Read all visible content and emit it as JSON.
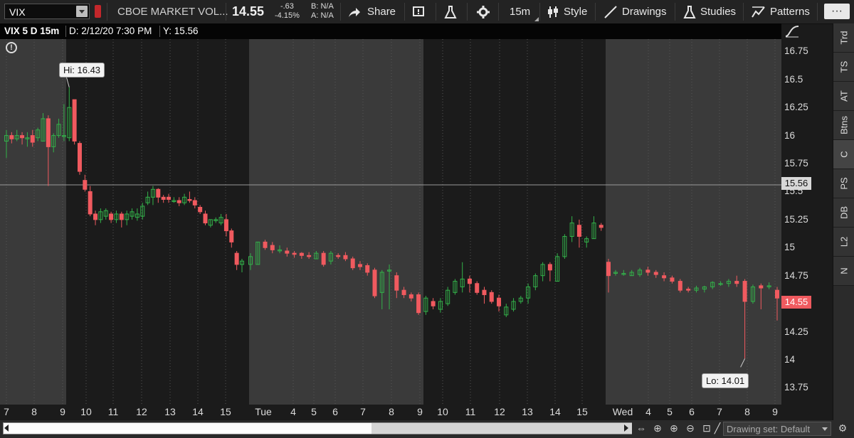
{
  "toolbar": {
    "symbol": "VIX",
    "description": "CBOE MARKET VOL...",
    "last_price": "14.55",
    "net_change": "-.63",
    "pct_change": "-4.15%",
    "bid": "B: N/A",
    "ask": "A: N/A",
    "share_label": "Share",
    "timeframe_label": "15m",
    "style_label": "Style",
    "drawings_label": "Drawings",
    "studies_label": "Studies",
    "patterns_label": "Patterns"
  },
  "header": {
    "title": "VIX 5 D 15m",
    "date": "D: 2/12/20 7:30 PM",
    "y_value": "Y: 15.56"
  },
  "price_axis": {
    "labels": [
      "16.75",
      "16.5",
      "16.25",
      "16",
      "15.75",
      "15.5",
      "15.25",
      "15",
      "14.75",
      "14.5",
      "14.25",
      "14",
      "13.75"
    ],
    "crosshair_value": "15.56",
    "last_value": "14.55"
  },
  "time_axis": {
    "labels": [
      "7",
      "8",
      "9",
      "10",
      "11",
      "12",
      "13",
      "14",
      "15",
      "Tue",
      "4",
      "5",
      "6",
      "7",
      "8",
      "9",
      "10",
      "11",
      "12",
      "13",
      "14",
      "15",
      "Wed",
      "4",
      "5",
      "6",
      "7",
      "8",
      "9"
    ]
  },
  "callouts": {
    "high": "Hi: 16.43",
    "low": "Lo: 14.01"
  },
  "right_tabs": [
    "Trd",
    "TS",
    "AT",
    "Btns",
    "C",
    "PS",
    "DB",
    "L2",
    "N"
  ],
  "footer": {
    "drawing_set": "Drawing set: Default"
  },
  "colors": {
    "up": "#33b24a",
    "down": "#f05a5f",
    "band_light": "#3a3a3a",
    "band_dark": "#1b1b1b",
    "crosshair": "#9a9a9a",
    "accent": "#3da8e0"
  },
  "chart_data": {
    "type": "candlestick",
    "ylim": [
      13.6,
      16.86
    ],
    "last_price": 14.55,
    "crosshair_y": 15.56,
    "high": 16.43,
    "low": 14.01,
    "candles": [
      [
        15.95,
        16.0,
        15.8,
        16.05
      ],
      [
        16.0,
        15.97,
        15.93,
        16.03
      ],
      [
        15.97,
        16.0,
        15.95,
        16.05
      ],
      [
        16.0,
        15.98,
        15.92,
        16.03
      ],
      [
        15.97,
        15.98,
        15.9,
        16.03
      ],
      [
        16.0,
        15.94,
        15.9,
        16.05
      ],
      [
        15.98,
        16.05,
        15.95,
        16.07
      ],
      [
        15.95,
        16.15,
        15.95,
        16.2
      ],
      [
        16.15,
        15.9,
        15.55,
        16.18
      ],
      [
        15.9,
        16.0,
        15.85,
        16.02
      ],
      [
        16.0,
        16.1,
        15.98,
        16.15
      ],
      [
        16.0,
        16.0,
        15.95,
        16.28
      ],
      [
        15.98,
        16.25,
        15.95,
        16.43
      ],
      [
        16.32,
        15.95,
        15.92,
        16.32
      ],
      [
        15.93,
        15.68,
        15.65,
        15.95
      ],
      [
        15.6,
        15.52,
        15.5,
        15.65
      ],
      [
        15.5,
        15.3,
        15.28,
        15.55
      ],
      [
        15.3,
        15.25,
        15.2,
        15.33
      ],
      [
        15.25,
        15.32,
        15.22,
        15.35
      ],
      [
        15.28,
        15.33,
        15.25,
        15.35
      ],
      [
        15.3,
        15.25,
        15.22,
        15.32
      ],
      [
        15.25,
        15.3,
        15.22,
        15.33
      ],
      [
        15.3,
        15.25,
        15.18,
        15.32
      ],
      [
        15.25,
        15.3,
        15.2,
        15.33
      ],
      [
        15.28,
        15.32,
        15.25,
        15.35
      ],
      [
        15.27,
        15.3,
        15.24,
        15.35
      ],
      [
        15.28,
        15.37,
        15.25,
        15.4
      ],
      [
        15.4,
        15.45,
        15.38,
        15.5
      ],
      [
        15.45,
        15.52,
        15.38,
        15.55
      ],
      [
        15.52,
        15.45,
        15.4,
        15.53
      ],
      [
        15.45,
        15.43,
        15.4,
        15.47
      ],
      [
        15.45,
        15.43,
        15.4,
        15.48
      ],
      [
        15.42,
        15.42,
        15.4,
        15.45
      ],
      [
        15.42,
        15.4,
        15.37,
        15.45
      ],
      [
        15.4,
        15.45,
        15.38,
        15.48
      ],
      [
        15.43,
        15.42,
        15.4,
        15.5
      ],
      [
        15.42,
        15.38,
        15.35,
        15.45
      ],
      [
        15.36,
        15.32,
        15.3,
        15.38
      ],
      [
        15.3,
        15.22,
        15.2,
        15.33
      ],
      [
        15.2,
        15.25,
        15.18,
        15.25
      ],
      [
        15.25,
        15.25,
        15.22,
        15.27
      ],
      [
        15.22,
        15.27,
        15.2,
        15.3
      ],
      [
        15.25,
        15.15,
        15.1,
        15.3
      ],
      [
        15.15,
        15.05,
        15.0,
        15.17
      ],
      [
        14.95,
        14.85,
        14.8,
        14.97
      ],
      [
        14.85,
        14.88,
        14.78,
        14.9
      ],
      [
        14.85,
        14.92,
        14.8,
        14.95
      ],
      [
        14.85,
        15.05,
        14.85,
        15.05
      ],
      [
        15.05,
        15.0,
        14.98,
        15.07
      ],
      [
        15.02,
        14.98,
        14.95,
        15.05
      ],
      [
        14.98,
        14.98,
        14.95,
        15.02
      ],
      [
        14.97,
        14.95,
        14.92,
        15.0
      ],
      [
        14.95,
        14.94,
        14.91,
        14.97
      ],
      [
        14.95,
        14.93,
        14.9,
        14.96
      ],
      [
        14.93,
        14.92,
        14.9,
        14.96
      ],
      [
        14.9,
        14.95,
        14.9,
        14.97
      ],
      [
        14.95,
        14.85,
        14.83,
        14.97
      ],
      [
        14.88,
        14.95,
        14.85,
        14.97
      ],
      [
        14.93,
        14.92,
        14.9,
        14.95
      ],
      [
        14.93,
        14.9,
        14.88,
        14.96
      ],
      [
        14.9,
        14.82,
        14.8,
        14.92
      ],
      [
        14.85,
        14.83,
        14.8,
        14.88
      ],
      [
        14.84,
        14.78,
        14.75,
        14.86
      ],
      [
        14.8,
        14.57,
        14.55,
        14.82
      ],
      [
        14.6,
        14.78,
        14.45,
        14.8
      ],
      [
        14.8,
        14.8,
        14.45,
        14.85
      ],
      [
        14.75,
        14.62,
        14.55,
        14.78
      ],
      [
        14.62,
        14.58,
        14.55,
        14.65
      ],
      [
        14.58,
        14.55,
        14.52,
        14.6
      ],
      [
        14.58,
        14.42,
        14.4,
        14.6
      ],
      [
        14.43,
        14.55,
        14.4,
        14.57
      ],
      [
        14.52,
        14.48,
        14.45,
        14.55
      ],
      [
        14.45,
        14.52,
        14.42,
        14.55
      ],
      [
        14.5,
        14.62,
        14.48,
        14.65
      ],
      [
        14.6,
        14.7,
        14.58,
        14.72
      ],
      [
        14.65,
        14.72,
        14.6,
        14.87
      ],
      [
        14.72,
        14.68,
        14.6,
        14.75
      ],
      [
        14.68,
        14.6,
        14.58,
        14.7
      ],
      [
        14.62,
        14.58,
        14.5,
        14.65
      ],
      [
        14.6,
        14.52,
        14.5,
        14.62
      ],
      [
        14.55,
        14.48,
        14.43,
        14.58
      ],
      [
        14.4,
        14.47,
        14.38,
        14.5
      ],
      [
        14.45,
        14.52,
        14.43,
        14.55
      ],
      [
        14.52,
        14.55,
        14.5,
        14.57
      ],
      [
        14.55,
        14.65,
        14.5,
        14.68
      ],
      [
        14.65,
        14.75,
        14.62,
        14.77
      ],
      [
        14.75,
        14.85,
        14.7,
        14.87
      ],
      [
        14.85,
        14.8,
        14.7,
        14.87
      ],
      [
        14.7,
        14.92,
        14.7,
        14.95
      ],
      [
        14.92,
        15.1,
        14.9,
        15.12
      ],
      [
        15.1,
        15.22,
        15.05,
        15.28
      ],
      [
        15.2,
        15.1,
        15.0,
        15.25
      ],
      [
        15.05,
        15.08,
        15.0,
        15.1
      ],
      [
        15.08,
        15.22,
        15.08,
        15.28
      ],
      [
        15.2,
        15.18,
        15.15,
        15.22
      ],
      [
        14.87,
        14.75,
        14.6,
        14.9
      ],
      [
        14.78,
        14.78,
        14.75,
        14.8
      ],
      [
        14.77,
        14.77,
        14.75,
        14.8
      ],
      [
        14.75,
        14.78,
        14.75,
        14.8
      ],
      [
        14.76,
        14.8,
        14.74,
        14.82
      ],
      [
        14.8,
        14.78,
        14.75,
        14.83
      ],
      [
        14.78,
        14.76,
        14.73,
        14.8
      ],
      [
        14.75,
        14.73,
        14.7,
        14.78
      ],
      [
        14.73,
        14.7,
        14.68,
        14.75
      ],
      [
        14.7,
        14.62,
        14.6,
        14.72
      ],
      [
        14.63,
        14.62,
        14.6,
        14.65
      ],
      [
        14.62,
        14.64,
        14.6,
        14.66
      ],
      [
        14.63,
        14.65,
        14.6,
        14.66
      ],
      [
        14.65,
        14.69,
        14.63,
        14.7
      ],
      [
        14.68,
        14.68,
        14.66,
        14.7
      ],
      [
        14.68,
        14.7,
        14.65,
        14.72
      ],
      [
        14.7,
        14.68,
        14.65,
        14.75
      ],
      [
        14.7,
        14.52,
        14.01,
        14.72
      ],
      [
        14.52,
        14.65,
        14.5,
        14.67
      ],
      [
        14.66,
        14.64,
        14.45,
        14.68
      ],
      [
        14.65,
        14.66,
        14.63,
        14.69
      ],
      [
        14.62,
        14.55,
        14.35,
        14.65
      ]
    ]
  }
}
